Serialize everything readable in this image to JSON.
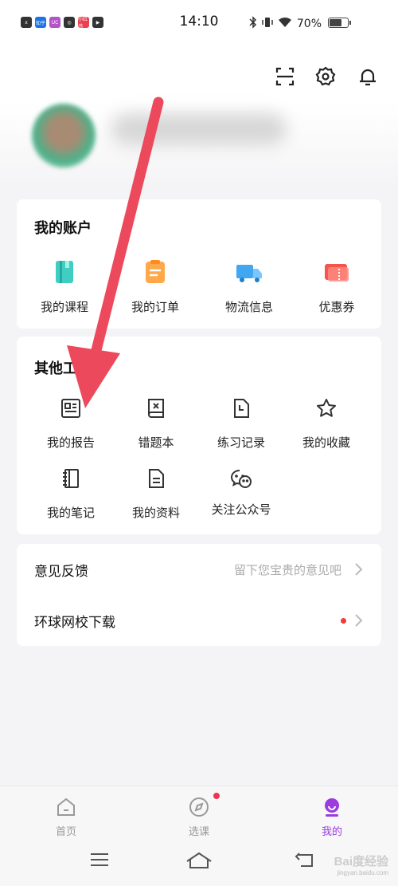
{
  "status_bar": {
    "apps": [
      "x",
      "知乎",
      "UC",
      "◎",
      "小红书",
      "▶"
    ],
    "time": "14:10",
    "battery_text": "70%",
    "battery_level": 0.7
  },
  "header": {
    "icons": [
      "scan-icon",
      "settings-icon",
      "bell-icon"
    ]
  },
  "account": {
    "title": "我的账户",
    "items": [
      {
        "label": "我的课程",
        "icon": "course-book-icon",
        "color": "#3ecfc2"
      },
      {
        "label": "我的订单",
        "icon": "order-clipboard-icon",
        "color": "#ff9d3a"
      },
      {
        "label": "物流信息",
        "icon": "delivery-truck-icon",
        "color": "#41a7f0"
      },
      {
        "label": "优惠券",
        "icon": "coupon-ticket-icon",
        "color": "#f5554b"
      }
    ]
  },
  "tools": {
    "title": "其他工具",
    "items": [
      {
        "label": "我的报告",
        "icon": "report-icon"
      },
      {
        "label": "错题本",
        "icon": "wrong-questions-book-icon"
      },
      {
        "label": "练习记录",
        "icon": "practice-record-icon"
      },
      {
        "label": "我的收藏",
        "icon": "star-icon"
      },
      {
        "label": "我的笔记",
        "icon": "notebook-icon"
      },
      {
        "label": "我的资料",
        "icon": "document-icon"
      },
      {
        "label": "关注公众号",
        "icon": "wechat-icon"
      }
    ]
  },
  "links": {
    "feedback": {
      "label": "意见反馈",
      "hint": "留下您宝贵的意见吧"
    },
    "download": {
      "label": "环球网校下载"
    }
  },
  "tabbar": {
    "tabs": [
      {
        "label": "首页",
        "icon": "home-icon"
      },
      {
        "label": "选课",
        "icon": "compass-icon"
      },
      {
        "label": "我的",
        "icon": "profile-icon"
      }
    ],
    "active_color": "#9b3be0"
  },
  "watermark": {
    "main": "Bai度经验",
    "sub": "jingyan.baidu.com"
  },
  "colors": {
    "annotation_arrow": "#ec4a5c",
    "accent": "#9b3be0"
  }
}
